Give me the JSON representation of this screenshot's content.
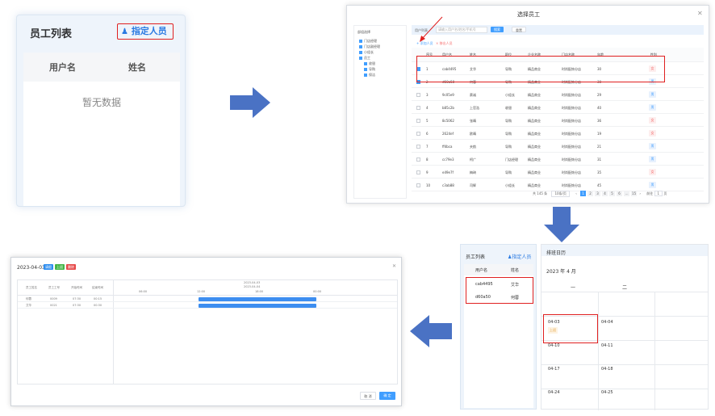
{
  "panel1": {
    "title": "员工列表",
    "assign_label": "指定人员",
    "columns": [
      "用户名",
      "姓名"
    ],
    "empty": "暂无数据"
  },
  "panel2": {
    "title": "选择员工",
    "tree": [
      "部组选择",
      "门店经理",
      "门店副经理",
      "小组长",
      "员工",
      "收银",
      "导购",
      "保洁"
    ],
    "filter_label": "用户列表",
    "filter_placeholder": "请输入用户名/姓名/手机号",
    "search_btn": "搜索",
    "reset_btn": "重置",
    "add_link": "+ 添加人员",
    "remove_link": "× 移出人员",
    "columns": [
      "序号",
      "用户名",
      "姓名",
      "职位",
      "企业名称",
      "门店名称",
      "年龄",
      "性别"
    ],
    "rows": [
      [
        "1",
        "cab4495",
        "艾华",
        "导购",
        "精品商业",
        "时尚配饰分店",
        "30",
        "女",
        true
      ],
      [
        "2",
        "d60a50",
        "何蓉",
        "导购",
        "精品商业",
        "时尚配饰分店",
        "30",
        "男",
        true
      ],
      [
        "3",
        "9c05e9",
        "蔡诚",
        "小组长",
        "精品商业",
        "时尚配饰分店",
        "29",
        "男",
        false
      ],
      [
        "4",
        "b85c2b",
        "上官浩",
        "收银",
        "精品商业",
        "时尚配饰分店",
        "40",
        "男",
        false
      ],
      [
        "5",
        "8c5062",
        "张晴",
        "导购",
        "精品商业",
        "时尚配饰分店",
        "36",
        "女",
        false
      ],
      [
        "6",
        "2624ef",
        "欧晴",
        "导购",
        "精品商业",
        "时尚配饰分店",
        "19",
        "女",
        false
      ],
      [
        "7",
        "ff4bca",
        "夫航",
        "导购",
        "精品商业",
        "时尚配饰分店",
        "21",
        "男",
        false
      ],
      [
        "8",
        "cc79e3",
        "柯广",
        "门店经理",
        "精品商业",
        "时尚配饰分店",
        "31",
        "男",
        false
      ],
      [
        "9",
        "e49e7f",
        "梅琦",
        "导购",
        "精品商业",
        "时尚配饰分店",
        "35",
        "女",
        false
      ],
      [
        "10",
        "c3ab88",
        "司辉",
        "小组长",
        "精品商业",
        "时尚配饰分店",
        "45",
        "男",
        false
      ]
    ],
    "pager": {
      "total": "共 145 条",
      "per_page": "10条/页",
      "pages": [
        "1",
        "2",
        "3",
        "4",
        "5",
        "6",
        "...",
        "15"
      ],
      "goto": "前往",
      "goto_value": "1",
      "page_suffix": "页"
    }
  },
  "panel3": {
    "list_title": "员工列表",
    "assign_label": "指定人员",
    "columns": [
      "用户名",
      "姓名"
    ],
    "rows": [
      [
        "cab4495",
        "艾华"
      ],
      [
        "d60a50",
        "何蓉"
      ]
    ],
    "cal_title": "排班日历",
    "month": "2023 年 4 月",
    "weekdays": [
      "一",
      "二"
    ],
    "dates": [
      [
        "04-03",
        "04-04"
      ],
      [
        "04-10",
        "04-11"
      ],
      [
        "04-17",
        "04-18"
      ],
      [
        "04-24",
        "04-25"
      ]
    ],
    "shift_tag": "上班"
  },
  "panel4": {
    "date": "2023-04-03",
    "tags": [
      {
        "label": "请假",
        "color": "#2f8ef0"
      },
      {
        "label": "上班",
        "color": "#45b649"
      },
      {
        "label": "删除",
        "color": "#e64b4b"
      }
    ],
    "columns": [
      "员工姓名",
      "员工工号",
      "开始时间",
      "结束时间"
    ],
    "timeline_top": "2023-04-03",
    "timeline_sub": "2023-04-04",
    "hours": [
      "06:00",
      "12:00",
      "18:00",
      "00:00"
    ],
    "rows": [
      {
        "name": "何蓉",
        "id": "0009",
        "start": "07:30",
        "end": "00:15"
      },
      {
        "name": "艾华",
        "id": "0021",
        "start": "07:30",
        "end": "00:30"
      }
    ],
    "cancel": "取 消",
    "confirm": "确 定"
  }
}
